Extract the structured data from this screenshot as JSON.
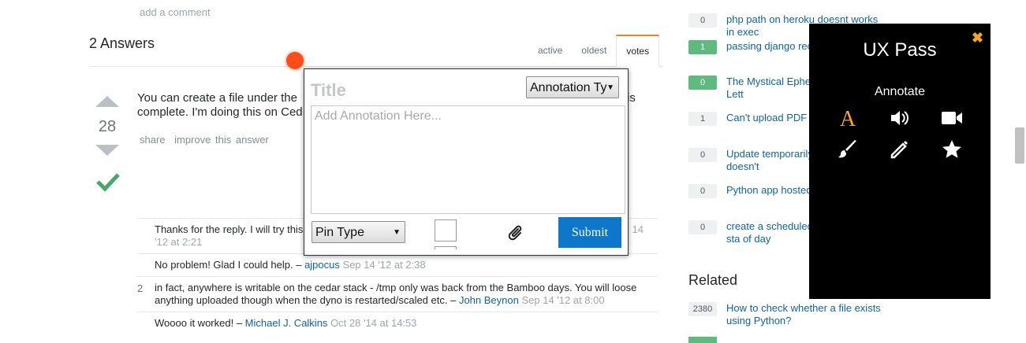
{
  "question": {
    "add_comment": "add a comment",
    "answers_title": "2 Answers",
    "sort_tabs": [
      "active",
      "oldest",
      "votes"
    ]
  },
  "answer": {
    "score": "28",
    "text_visible": "You can create a file under the",
    "text_line2": "complete. I'm doing this on Ced",
    "text_tail": "is",
    "share": "share",
    "improve": "improve this answer"
  },
  "comments": [
    {
      "score": "",
      "text": "Thanks for the reply. I will try this",
      "tail": "14",
      "date_line2": "'12 at 2:21"
    },
    {
      "score": "",
      "text": "No problem! Glad I could help. –",
      "user": "ajpocus",
      "date": "Sep 14 '12 at 2:38"
    },
    {
      "score": "2",
      "text": "in fact, anywhere is writable on the cedar stack - /tmp only was back from the Bamboo days. You will loose anything uploaded though when the dyno is restarted/scaled etc. –",
      "user": "John Beynon",
      "date": "Sep 14 '12 at 8:00"
    },
    {
      "score": "",
      "text": "Woooo it worked! –",
      "user": "Michael J. Calkins",
      "date": "Oct 28 '14 at 14:53"
    }
  ],
  "sidebar": {
    "linked": [
      {
        "count": "0",
        "green": false,
        "text": "php path on heroku doesnt works in exec"
      },
      {
        "count": "1",
        "green": true,
        "text": "passing django rec task"
      },
      {
        "count": "0",
        "green": true,
        "text": "The Mystical Ephe Heroku is Not Lett"
      },
      {
        "count": "1",
        "green": false,
        "text": "Can't upload PDF Heroku?"
      },
      {
        "count": "0",
        "green": false,
        "text": "Update temporarily filesystem doesn't"
      },
      {
        "count": "0",
        "green": false,
        "text": "Python app hosted created"
      },
      {
        "count": "0",
        "green": false,
        "text": "create a scheduled root page by a sta of day"
      }
    ],
    "related_title": "Related",
    "related": [
      {
        "count": "2380",
        "green": false,
        "text": "How to check whether a file exists using Python?"
      }
    ]
  },
  "ux_pass": {
    "title": "UX Pass",
    "close": "✖",
    "subtitle": "Annotate",
    "tools": [
      "text-icon",
      "audio-icon",
      "video-icon",
      "brush-icon",
      "pencil-icon",
      "star-icon"
    ],
    "accent_color": "#f5a623"
  },
  "annotation_dialog": {
    "title_placeholder": "Title",
    "type_select": "Annotation Ty",
    "body_placeholder": "Add Annotation Here...",
    "pin_type": "Pin Type",
    "submit": "Submit"
  }
}
